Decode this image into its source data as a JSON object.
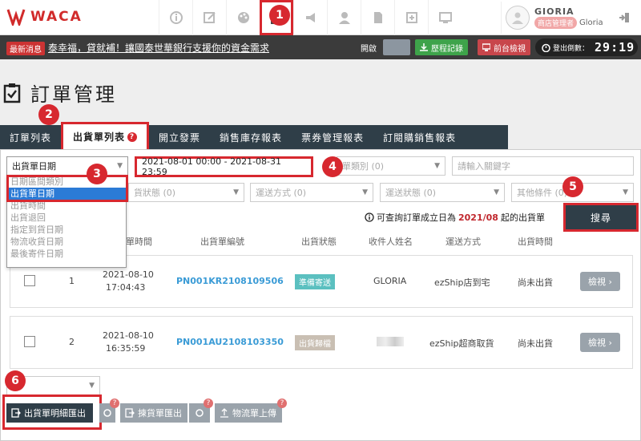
{
  "app": {
    "logo_text": "WACA"
  },
  "user": {
    "name": "GIORIA",
    "role": "商店管理者",
    "sub_name": "Gloria"
  },
  "news": {
    "tag": "最新消息",
    "text": "泰幸福，貸就補！讓國泰世華銀行支援你的資金需求"
  },
  "top_controls": {
    "open_label": "開啟",
    "history_label": "歷程記錄",
    "preview_label": "前台檢視",
    "countdown_label": "登出倒數：",
    "countdown_value": "29:19"
  },
  "page": {
    "title": "訂單管理"
  },
  "tabs": [
    {
      "label": "訂單列表"
    },
    {
      "label": "出貨單列表"
    },
    {
      "label": "開立發票"
    },
    {
      "label": "銷售庫存報表"
    },
    {
      "label": "票券管理報表"
    },
    {
      "label": "訂閱購銷售報表"
    }
  ],
  "filters": {
    "date_type_value": "出貨單日期",
    "date_range_value": "2021-08-01 00:00 - 2021-08-31 23:59",
    "order_type_placeholder": "單類別 (0)",
    "keyword_placeholder": "請輸入關鍵字",
    "ship_status_placeholder": "貨狀態 (0)",
    "delivery_method_placeholder": "運送方式 (0)",
    "delivery_status_placeholder": "運送狀態 (0)",
    "other_conditions_placeholder": "其他條件 (0)",
    "date_type_options": [
      {
        "label": "日期區間類別",
        "selected": false
      },
      {
        "label": "出貨單日期",
        "selected": true
      },
      {
        "label": "出貨時間",
        "selected": false
      },
      {
        "label": "出貨退回",
        "selected": false
      },
      {
        "label": "指定到貨日期",
        "selected": false
      },
      {
        "label": "物流收貨日期",
        "selected": false
      },
      {
        "label": "最後寄件日期",
        "selected": false
      }
    ]
  },
  "notice": {
    "prefix": "可查詢訂單成立日為",
    "month": "2021/08",
    "suffix": "起的出貨單"
  },
  "search_button": "搜尋",
  "table": {
    "headers": [
      "貨單時間",
      "出貨單編號",
      "出貨狀態",
      "收件人姓名",
      "運送方式",
      "出貨時間"
    ],
    "rows": [
      {
        "index": "1",
        "date": "2021-08-10",
        "time": "17:04:43",
        "order_no": "PN001KR2108109506",
        "status": "準備寄送",
        "status_color": "#5bc0c0",
        "recipient": "GLORIA",
        "delivery": "ezShip店到宅",
        "ship_time": "尚未出貨",
        "view_label": "檢視"
      },
      {
        "index": "2",
        "date": "2021-08-10",
        "time": "16:35:59",
        "order_no": "PN001AU2108103350",
        "status": "出貨歸檔",
        "status_color": "#c9bfb3",
        "recipient": "",
        "delivery": "ezShip超商取貨",
        "ship_time": "尚未出貨",
        "view_label": "檢視"
      }
    ]
  },
  "bottom": {
    "export_detail": "出貨單明細匯出",
    "export_pick": "揀貨單匯出",
    "upload_logistics": "物流單上傳"
  },
  "step_badges": [
    "1",
    "2",
    "3",
    "4",
    "5",
    "6"
  ],
  "colors": {
    "accent_red": "#d7282f",
    "dark_nav": "#2f3e48",
    "link_blue": "#3a9bd6"
  }
}
